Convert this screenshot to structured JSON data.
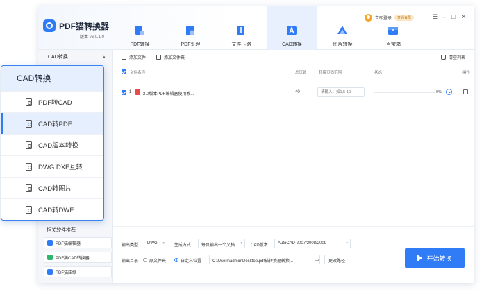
{
  "app": {
    "title": "PDF猫转换器",
    "version": "版本 v6.0.1.0",
    "login_text": "立即登录",
    "vip_text": "开通会员",
    "window_controls": [
      "menu-icon",
      "minimize-icon",
      "maximize-icon",
      "close-icon"
    ]
  },
  "nav": [
    {
      "label": "PDF转换",
      "icon": "pdf-convert-icon",
      "color": "#2f7cf6"
    },
    {
      "label": "PDF处理",
      "icon": "pdf-process-icon",
      "color": "#2f7cf6"
    },
    {
      "label": "文件压缩",
      "icon": "compress-icon",
      "color": "#2f7cf6"
    },
    {
      "label": "CAD转换",
      "icon": "cad-icon",
      "color": "#2f7cf6",
      "active": true
    },
    {
      "label": "图片转换",
      "icon": "image-icon",
      "color": "#2f7cf6"
    },
    {
      "label": "百宝箱",
      "icon": "toolbox-icon",
      "color": "#2f7cf6"
    }
  ],
  "sidebar": {
    "header": "CAD转换",
    "recommend_title": "相关软件推荐",
    "recommend": [
      {
        "label": "PDF猫编辑器",
        "color": "#2f7cf6"
      },
      {
        "label": "PDF猫CAD转换器",
        "color": "#2fb66e"
      },
      {
        "label": "PDF猫压缩",
        "color": "#2f7cf6"
      }
    ]
  },
  "callout": {
    "header": "CAD转换",
    "items": [
      {
        "label": "PDF转CAD",
        "icon": "pdf-file-icon"
      },
      {
        "label": "CAD转PDF",
        "icon": "cad-file-icon",
        "active": true
      },
      {
        "label": "CAD版本转换",
        "icon": "cad-version-icon"
      },
      {
        "label": "DWG DXF互转",
        "icon": "dwg-file-icon"
      },
      {
        "label": "CAD转图片",
        "icon": "image-file-icon"
      },
      {
        "label": "CAD转DWF",
        "icon": "dwf-file-icon"
      }
    ]
  },
  "toolbar": {
    "add_file": "添加文件",
    "add_folder": "添加文件夹",
    "clear_list": "清空列表"
  },
  "table": {
    "headers": {
      "name": "文件名称",
      "pages": "总页数",
      "range": "转换页码范围",
      "status": "状态",
      "ops": "操作"
    },
    "rows": [
      {
        "index": "1",
        "name": "2.0版本PDF编辑器使用教...",
        "pages": "40",
        "range_placeholder": "请输入：如1,5-10",
        "progress": 0,
        "progress_text": "0%"
      }
    ]
  },
  "bottom": {
    "output_type_label": "输出类型",
    "output_type_value": "DWG",
    "gen_mode_label": "生成方式",
    "gen_mode_value": "每页输出一个文档",
    "cad_version_label": "CAD版本",
    "cad_version_value": "AutoCAD 2007/2008/2009",
    "output_dir_label": "输出目录",
    "radio_original": "原文件夹",
    "radio_custom": "自定义位置",
    "path_value": "C:\\Users\\admin\\Desktop\\pdf猫转换器转换...",
    "change_path": "更改路径",
    "start": "开始转换"
  }
}
